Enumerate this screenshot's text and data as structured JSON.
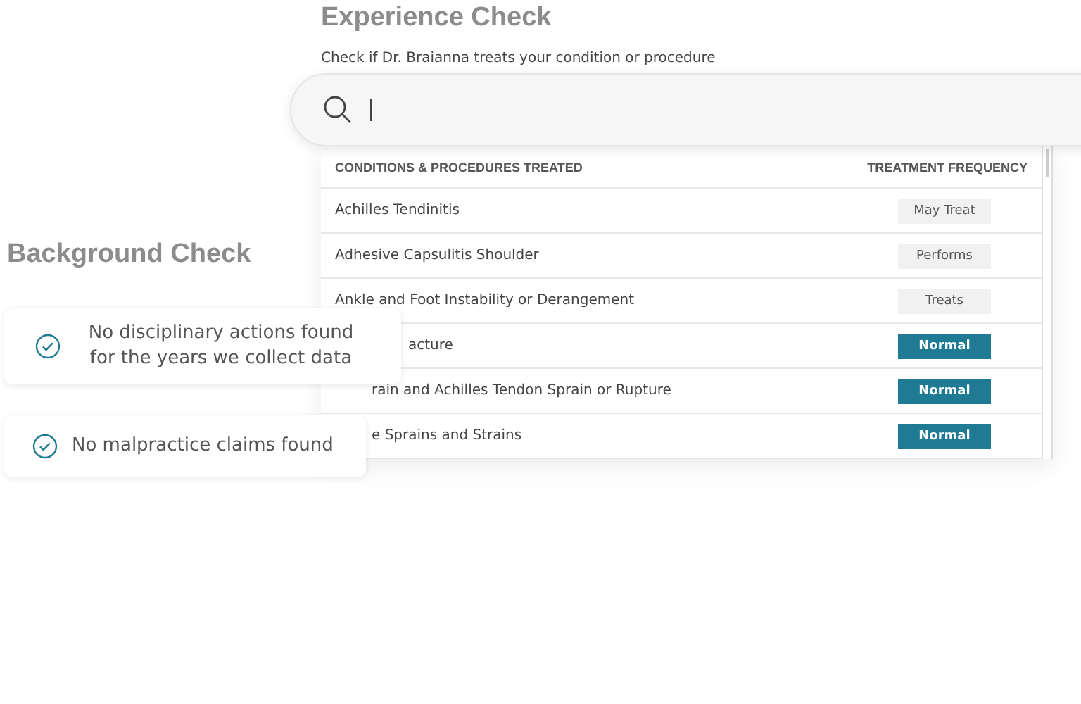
{
  "experience": {
    "title": "Experience Check",
    "subtitle": "Check if Dr. Braianna treats your condition or procedure",
    "table": {
      "columns": [
        "CONDITIONS & PROCEDURES TREATED",
        "TREATMENT FREQUENCY"
      ],
      "rows": [
        {
          "condition": "Achilles Tendinitis",
          "frequency": "May Treat",
          "kind": "plain"
        },
        {
          "condition": "Adhesive Capsulitis Shoulder",
          "frequency": "Performs",
          "kind": "plain"
        },
        {
          "condition": "Ankle and Foot Instability or Derangement",
          "frequency": "Treats",
          "kind": "plain"
        },
        {
          "condition": "acture",
          "frequency": "Normal",
          "kind": "highlight"
        },
        {
          "condition": "rain and Achilles Tendon Sprain or Rupture",
          "frequency": "Normal",
          "kind": "highlight"
        },
        {
          "condition": "e Sprains and Strains",
          "frequency": "Normal",
          "kind": "highlight"
        }
      ]
    }
  },
  "background": {
    "title": "Background Check",
    "findings": [
      "No disciplinary actions found for the years we collect data",
      "No malpractice claims found"
    ]
  }
}
